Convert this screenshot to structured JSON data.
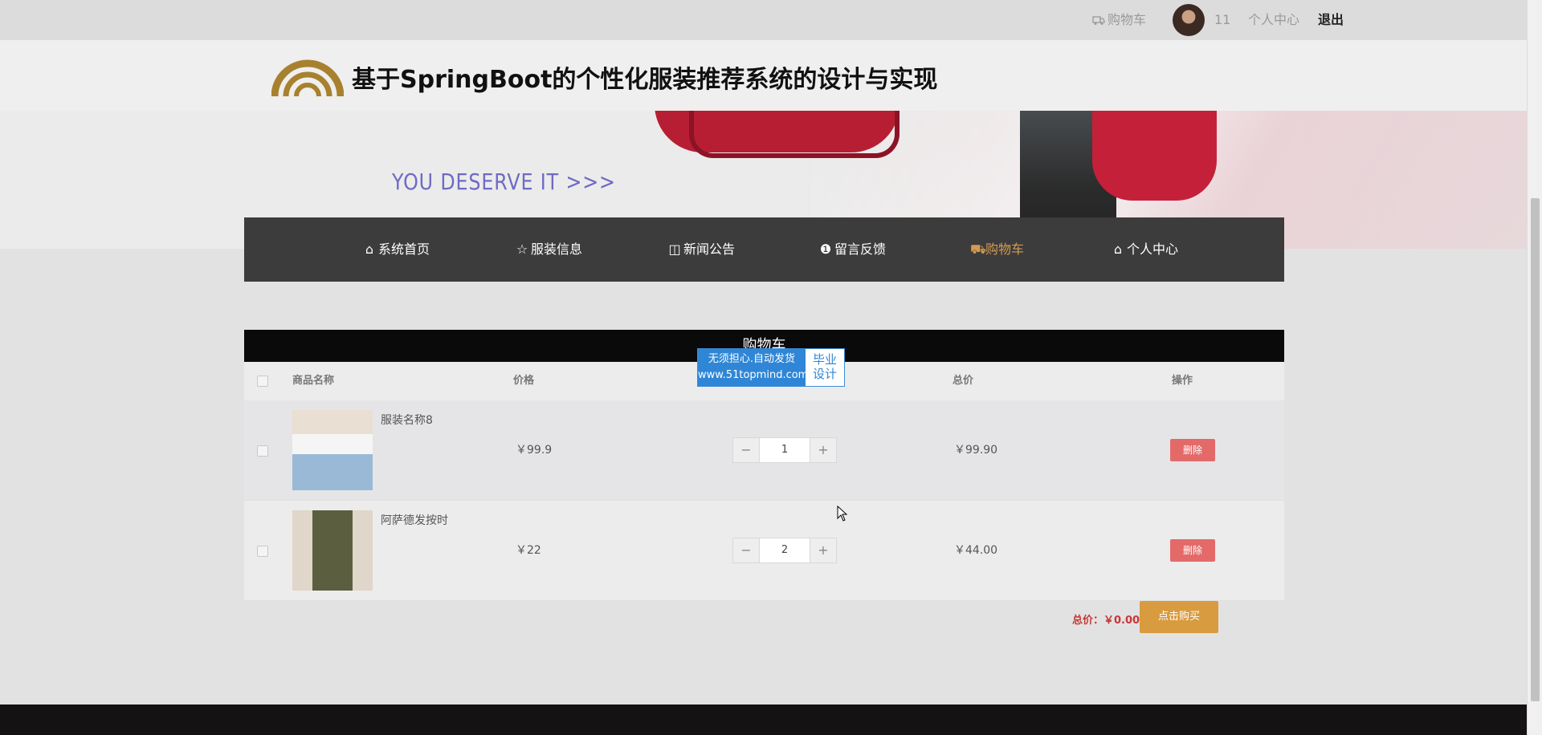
{
  "topbar": {
    "cart_label": "购物车",
    "username": "11",
    "personal_center": "个人中心",
    "logout": "退出"
  },
  "header": {
    "title": "基于SpringBoot的个性化服装推荐系统的设计与实现"
  },
  "banner": {
    "slogan": "YOU DESERVE IT  >>>"
  },
  "nav": {
    "items": [
      {
        "label": "系统首页",
        "icon": "home-icon"
      },
      {
        "label": "服装信息",
        "icon": "star-icon"
      },
      {
        "label": "新闻公告",
        "icon": "bag-icon"
      },
      {
        "label": "留言反馈",
        "icon": "info-icon"
      },
      {
        "label": "购物车",
        "icon": "truck-icon",
        "active": true
      },
      {
        "label": "个人中心",
        "icon": "home-icon"
      }
    ]
  },
  "cart": {
    "title": "购物车",
    "columns": [
      "商品名称",
      "价格",
      "总价",
      "操作"
    ],
    "rows": [
      {
        "name": "服装名称8",
        "price": "￥99.9",
        "qty": "1",
        "total": "￥99.90",
        "action": "删除"
      },
      {
        "name": "阿萨德发按时",
        "price": "￥22",
        "qty": "2",
        "total": "￥44.00",
        "action": "删除"
      }
    ],
    "summary_label": "总价：￥0.00",
    "buy_label": "点击购买"
  },
  "watermark": {
    "line1": "无须担心.自动发货",
    "line2": "www.51topmind.com",
    "side1": "毕业",
    "side2": "设计"
  },
  "colors": {
    "accent": "#d49b50",
    "nav_bg": "#3c3c3c",
    "delete": "#e46a6a",
    "buy": "#d99b3f"
  }
}
